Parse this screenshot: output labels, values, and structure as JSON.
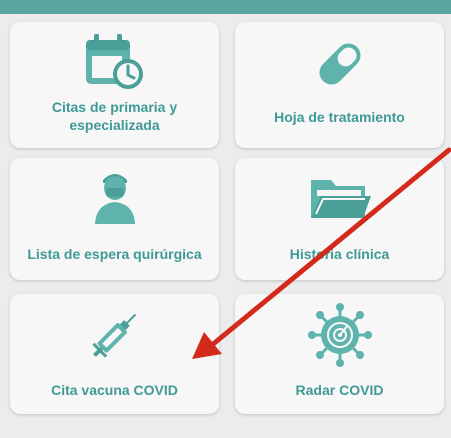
{
  "colors": {
    "accent": "#3f9a95",
    "topbar": "#5aa7a0",
    "arrow": "#d42a1c"
  },
  "tiles": [
    {
      "label": "Citas de primaria y especializada",
      "icon": "calendar-clock-icon"
    },
    {
      "label": "Hoja de tratamiento",
      "icon": "pill-icon"
    },
    {
      "label": "Lista de espera quirúrgica",
      "icon": "surgeon-icon"
    },
    {
      "label": "Historia clínica",
      "icon": "folder-icon"
    },
    {
      "label": "Cita vacuna COVID",
      "icon": "syringe-icon"
    },
    {
      "label": "Radar COVID",
      "icon": "virus-icon"
    }
  ]
}
